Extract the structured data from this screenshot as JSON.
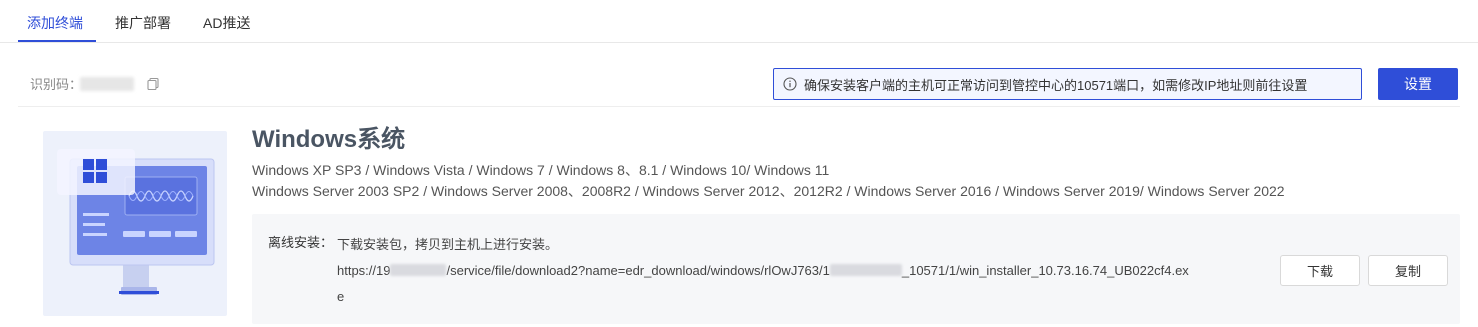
{
  "tabs": [
    {
      "label": "添加终端",
      "active": true
    },
    {
      "label": "推广部署",
      "active": false
    },
    {
      "label": "AD推送",
      "active": false
    }
  ],
  "toolbar": {
    "id_label": "识别码：",
    "notice": "确保安装客户端的主机可正常访问到管控中心的10571端口，如需修改IP地址则前往设置",
    "settings_label": "设置"
  },
  "product": {
    "title": "Windows系统",
    "supported_line_1": "Windows XP SP3 / Windows Vista / Windows 7 / Windows 8、8.1 / Windows 10/ Windows 11",
    "supported_line_2": "Windows Server 2003 SP2 / Windows Server 2008、2008R2 / Windows Server 2012、2012R2 / Windows Server 2016 / Windows Server 2019/ Windows Server 2022"
  },
  "offline": {
    "label": "离线安装：",
    "description": "下载安装包，拷贝到主机上进行安装。",
    "url_prefix": "https://19",
    "url_middle_1": "/service/file/download2?name=edr_download/windows/rlOwJ763/1",
    "url_middle_2": "_10571/1/win_installer_10.73.16.74_UB022cf4.ex",
    "url_wrap": "e",
    "download_label": "下载",
    "copy_label": "复制"
  },
  "colors": {
    "accent": "#2f4ed8",
    "notice_bg": "#f3f6ff",
    "panel_bg": "#f6f7f9"
  }
}
